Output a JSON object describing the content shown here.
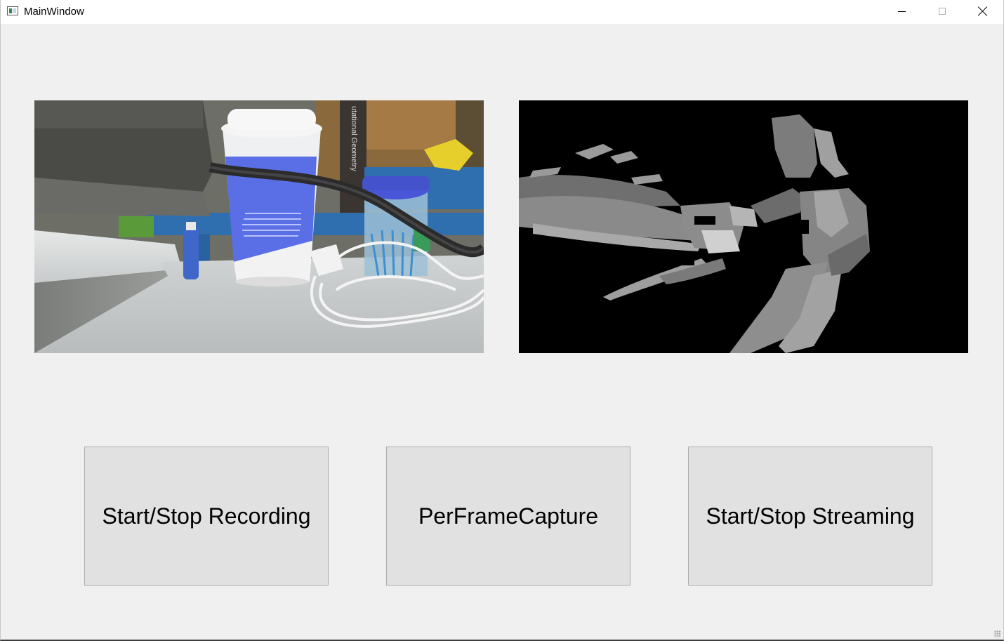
{
  "window": {
    "title": "MainWindow",
    "controls": {
      "minimize": "minimize-icon",
      "maximize": "maximize-icon",
      "close": "close-icon"
    }
  },
  "panels": {
    "rgb": {
      "book_spine_text": "utational Geometry",
      "colors": {
        "cup_sleeve": "#5a6ee6",
        "cable": "#2b2b2b",
        "shelf": "#2f6fb0"
      }
    },
    "depth": {
      "colors": {
        "background": "#000000",
        "surface": "#8a8a8a"
      }
    }
  },
  "buttons": {
    "record_label": "Start/Stop Recording",
    "capture_label": "PerFrameCapture",
    "stream_label": "Start/Stop Streaming"
  }
}
